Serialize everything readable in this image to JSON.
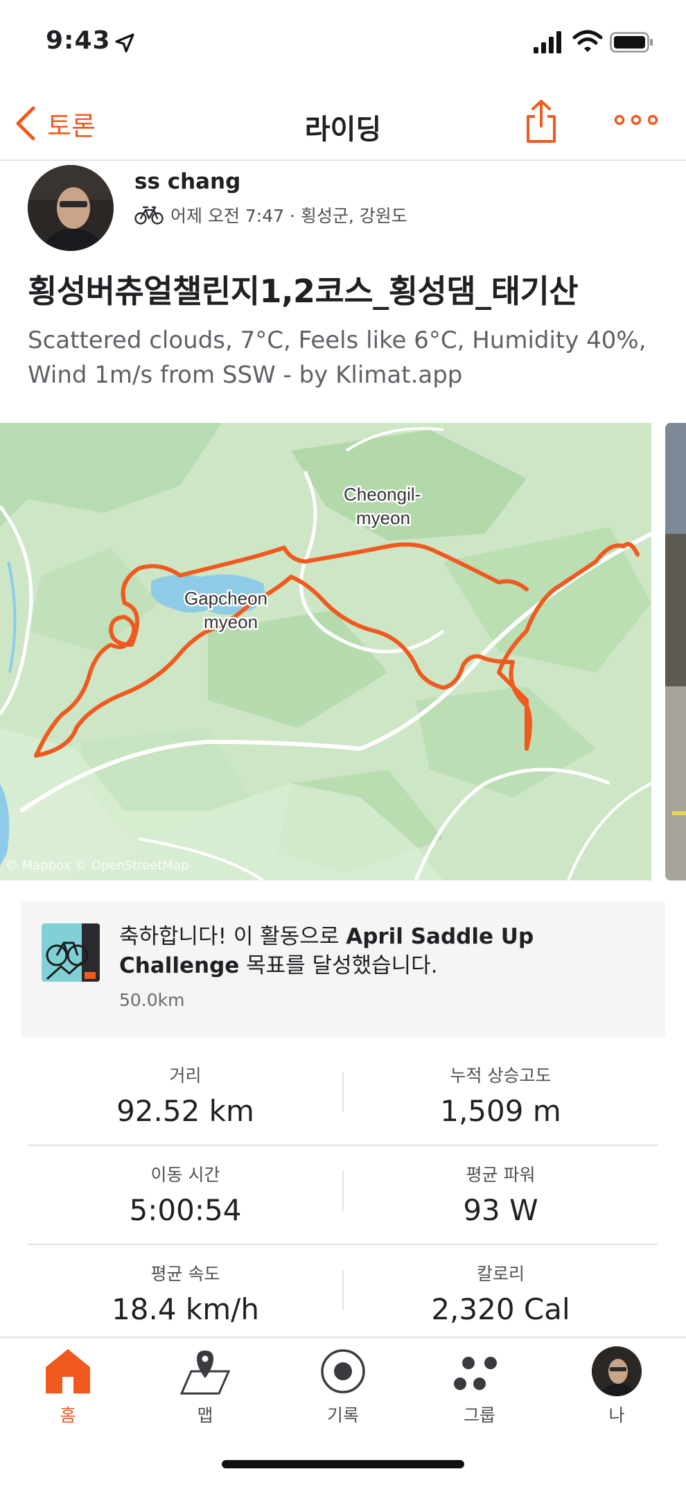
{
  "status": {
    "time": "9:43"
  },
  "nav": {
    "back_label": "토론",
    "title": "라이딩"
  },
  "athlete": {
    "name": "ss chang",
    "meta": "어제 오전 7:47 · 횡성군, 강원도"
  },
  "activity": {
    "title": "횡성버츄얼챌린지1,2코스_횡성댐_태기산",
    "description": "Scattered clouds, 7°C, Feels like 6°C, Humidity 40%, Wind 1m/s from SSW - by Klimat.app"
  },
  "map": {
    "labels": {
      "cheongil_1": "Cheongil-",
      "cheongil_2": "myeon",
      "gapcheon_1": "Gapcheon",
      "gapcheon_2": "myeon"
    },
    "attribution": "© Mapbox © OpenStreetMap",
    "route_color": "#f05a1e"
  },
  "challenge": {
    "text_prefix": "축하합니다! 이 활동으로 ",
    "challenge_name": "April Saddle Up Challenge",
    "text_suffix": " 목표를 달성했습니다.",
    "distance": "50.0km"
  },
  "stats": [
    {
      "label": "거리",
      "value": "92.52 km"
    },
    {
      "label": "누적 상승고도",
      "value": "1,509 m"
    },
    {
      "label": "이동 시간",
      "value": "5:00:54"
    },
    {
      "label": "평균 파워",
      "value": "93 W"
    },
    {
      "label": "평균 속도",
      "value": "18.4 km/h"
    },
    {
      "label": "칼로리",
      "value": "2,320 Cal"
    }
  ],
  "tabs": [
    {
      "label": "홈",
      "icon": "home-icon",
      "active": true
    },
    {
      "label": "맵",
      "icon": "map-icon",
      "active": false
    },
    {
      "label": "기록",
      "icon": "record-icon",
      "active": false
    },
    {
      "label": "그룹",
      "icon": "groups-icon",
      "active": false
    },
    {
      "label": "나",
      "icon": "profile-avatar",
      "active": false
    }
  ],
  "colors": {
    "accent": "#f05a1e",
    "text": "#1f1f24",
    "muted": "#5f5f66",
    "map_green": "#cfe8c9"
  }
}
